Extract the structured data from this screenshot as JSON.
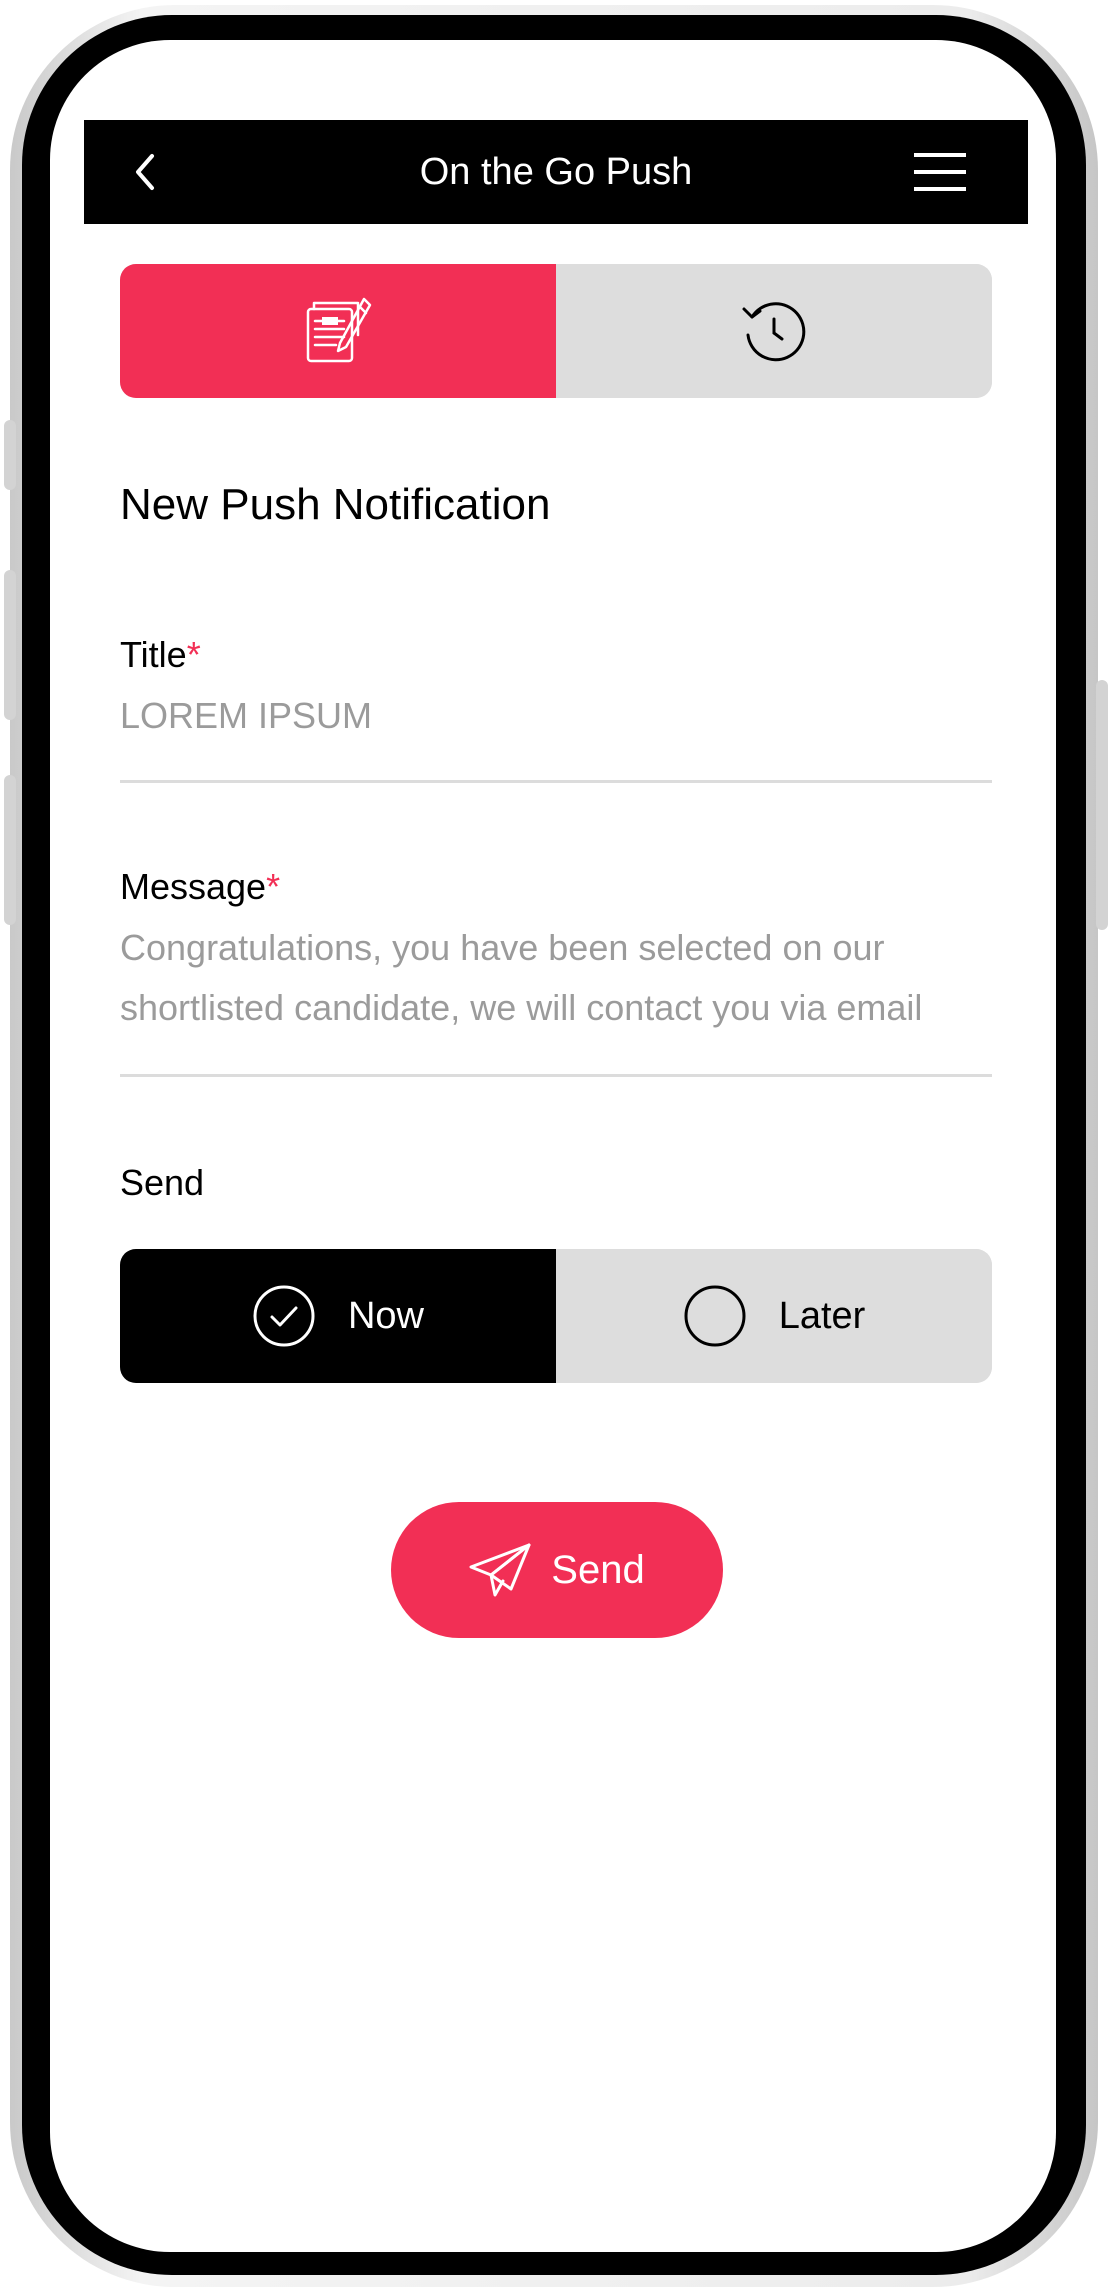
{
  "header": {
    "title": "On the Go Push",
    "back_icon": "chevron-left-icon",
    "menu_icon": "hamburger-menu-icon"
  },
  "tabs": [
    {
      "name": "compose",
      "icon": "document-edit-icon",
      "active": true
    },
    {
      "name": "history",
      "icon": "history-clock-icon",
      "active": false
    }
  ],
  "form": {
    "heading": "New Push Notification",
    "title_label": "Title",
    "title_required": "*",
    "title_value": "LOREM IPSUM",
    "message_label": "Message",
    "message_required": "*",
    "message_line1": "Congratulations, you have been selected on our",
    "message_line2": "shortlisted candidate, we will contact you via email",
    "send_label": "Send",
    "send_options": {
      "now_label": "Now",
      "later_label": "Later",
      "selected": "Now"
    }
  },
  "actions": {
    "send_button_label": "Send",
    "send_icon": "paper-plane-icon"
  },
  "colors": {
    "accent": "#f22f55",
    "header_bg": "#000000",
    "inactive_bg": "#dddddd",
    "placeholder_text": "#9b9b9b"
  }
}
